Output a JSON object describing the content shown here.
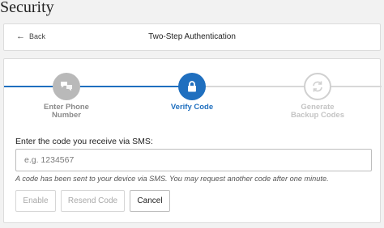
{
  "page": {
    "title": "Security"
  },
  "header": {
    "back_label": "Back",
    "title": "Two-Step Authentication"
  },
  "steps": [
    {
      "line1": "Enter Phone",
      "line2": "Number",
      "state": "done",
      "icon": "chat-bubbles-icon"
    },
    {
      "line1": "Verify Code",
      "line2": "",
      "state": "active",
      "icon": "lock-icon"
    },
    {
      "line1": "Generate",
      "line2": "Backup Codes",
      "state": "pending",
      "icon": "refresh-icon"
    }
  ],
  "form": {
    "label": "Enter the code you receive via SMS:",
    "input_value": "",
    "placeholder": "e.g. 1234567",
    "hint": "A code has been sent to your device via SMS. You may request another code after one minute."
  },
  "buttons": {
    "enable": "Enable",
    "resend": "Resend Code",
    "cancel": "Cancel"
  },
  "colors": {
    "accent": "#1f6fbf",
    "done": "#b9b9b9",
    "pending": "#d0d0d0"
  }
}
